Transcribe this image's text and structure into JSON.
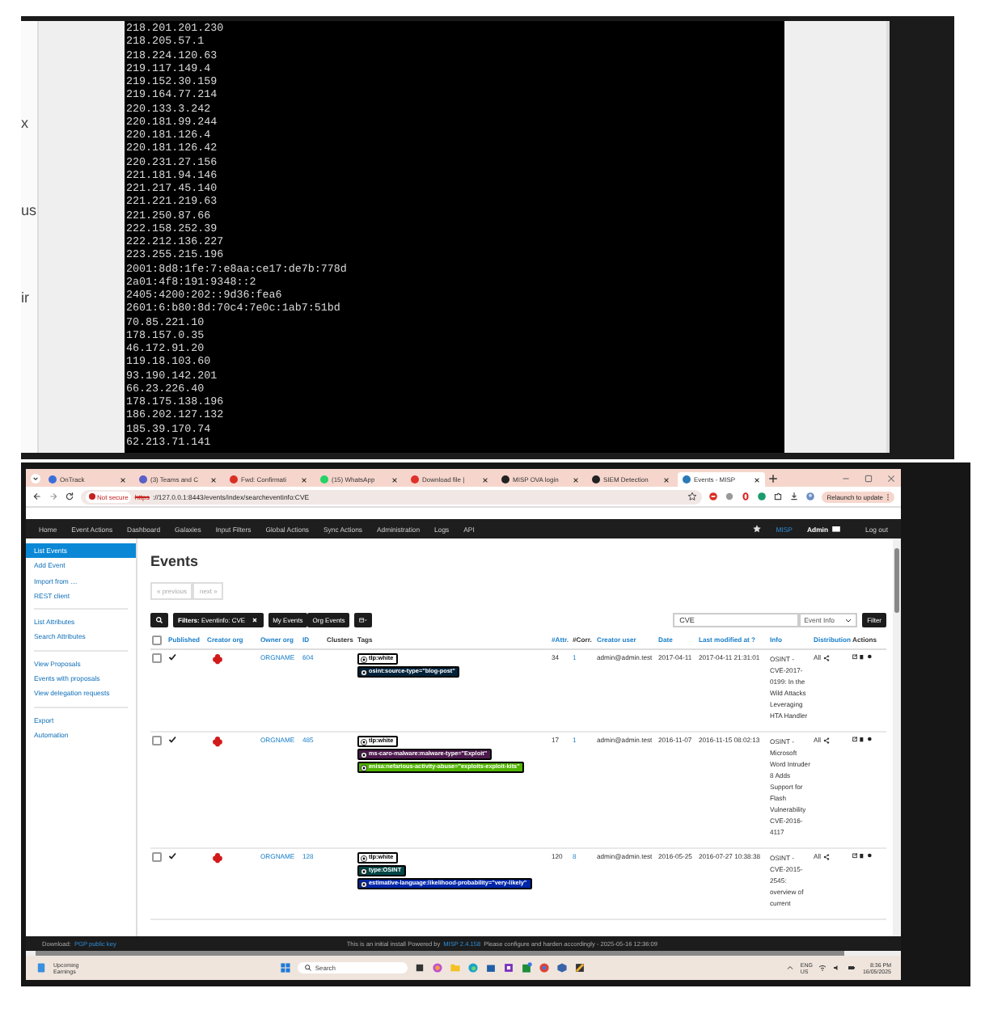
{
  "terminal": {
    "side_fragments": [
      "x",
      "us",
      "ir"
    ],
    "lines": [
      "218.201.201.230",
      "218.205.57.1",
      "218.224.120.63",
      "219.117.149.4",
      "219.152.30.159",
      "219.164.77.214",
      "220.133.3.242",
      "220.181.99.244",
      "220.181.126.4",
      "220.181.126.42",
      "220.231.27.156",
      "221.181.94.146",
      "221.217.45.140",
      "221.221.219.63",
      "221.250.87.66",
      "222.158.252.39",
      "222.212.136.227",
      "223.255.215.196",
      "2001:8d8:1fe:7:e8aa:ce17:de7b:778d",
      "2a01:4f8:191:9348::2",
      "2405:4200:202::9d36:fea6",
      "2601:6:b80:8d:70c4:7e0c:1ab7:51bd",
      "70.85.221.10",
      "178.157.0.35",
      "46.172.91.20",
      "119.18.103.60",
      "93.190.142.201",
      "66.23.226.40",
      "178.175.138.196",
      "186.202.127.132",
      "185.39.170.74",
      "62.213.71.141"
    ]
  },
  "browser": {
    "tabs": [
      {
        "label": "OnTrack",
        "selected": false,
        "color": "#3b6fd8"
      },
      {
        "label": "(3) Teams and C",
        "selected": false,
        "color": "#5b5fc7"
      },
      {
        "label": "Fwd: Confirmati",
        "selected": false,
        "color": "#d93025"
      },
      {
        "label": "(15) WhatsApp",
        "selected": false,
        "color": "#25d366"
      },
      {
        "label": "Download file | ",
        "selected": false,
        "color": "#e0302a"
      },
      {
        "label": "MISP OVA login",
        "selected": false,
        "color": "#222222"
      },
      {
        "label": "SIEM Detection",
        "selected": false,
        "color": "#222222"
      },
      {
        "label": "Events - MISP",
        "selected": true,
        "color": "#2a7ab8"
      }
    ],
    "security": "Not secure",
    "url_scheme": "https",
    "url_rest": "://127.0.0.1:8443/events/index/searcheventinfo:CVE",
    "relaunch": "Relaunch to update"
  },
  "nav": {
    "items": [
      "Home",
      "Event Actions",
      "Dashboard",
      "Galaxies",
      "Input Filters",
      "Global Actions",
      "Sync Actions",
      "Administration",
      "Logs",
      "API"
    ],
    "brand": "MISP",
    "user": "Admin",
    "logout": "Log out"
  },
  "sidebar": {
    "groups": [
      [
        {
          "label": "List Events",
          "selected": true
        },
        {
          "label": "Add Event",
          "selected": false
        },
        {
          "label": "Import from …",
          "selected": false
        },
        {
          "label": "REST client",
          "selected": false
        }
      ],
      [
        {
          "label": "List Attributes",
          "selected": false
        },
        {
          "label": "Search Attributes",
          "selected": false
        }
      ],
      [
        {
          "label": "View Proposals",
          "selected": false
        },
        {
          "label": "Events with proposals",
          "selected": false
        },
        {
          "label": "View delegation requests",
          "selected": false
        }
      ],
      [
        {
          "label": "Export",
          "selected": false
        },
        {
          "label": "Automation",
          "selected": false
        }
      ]
    ]
  },
  "main": {
    "title": "Events",
    "pager": [
      "« previous",
      "next »"
    ],
    "filter_tag": "**Filters:** Eventinfo: CVE",
    "my_events": "My Events",
    "org_events": "Org Events",
    "search_value": "CVE",
    "search_scope": "Event Info",
    "filter_button": "Filter"
  },
  "table": {
    "select_all_checked": false,
    "columns": [
      {
        "label": "Published",
        "sortable": true
      },
      {
        "label": "Creator org",
        "sortable": true
      },
      {
        "label": "Owner org",
        "sortable": true
      },
      {
        "label": "ID",
        "sortable": true
      },
      {
        "label": "Clusters",
        "sortable": false
      },
      {
        "label": "Tags",
        "sortable": false
      },
      {
        "label": "#Attr.",
        "sortable": true
      },
      {
        "label": "#Corr.",
        "sortable": false
      },
      {
        "label": "Creator user",
        "sortable": true
      },
      {
        "label": "Date",
        "sortable": true
      },
      {
        "label": "Last modified at ?",
        "sortable": true
      },
      {
        "label": "Info",
        "sortable": true
      },
      {
        "label": "Distribution",
        "sortable": true
      },
      {
        "label": "Actions",
        "sortable": false
      }
    ],
    "rows": [
      {
        "checked": false,
        "published": true,
        "owner_org": "ORGNAME",
        "id": "604",
        "tags": [
          {
            "label": "tlp:white",
            "color": "#ffffff"
          },
          {
            "label": "osint:source-type=\"blog-post\"",
            "color": "#00223b"
          }
        ],
        "attr": "34",
        "corr": "1",
        "creator_user": "admin@admin.test",
        "date": "2017-04-11",
        "modified": "2017-04-11 21:31:01",
        "info": "OSINT - CVE-2017-0199: In the Wild Attacks Leveraging HTA Handler",
        "distribution": "All"
      },
      {
        "checked": false,
        "published": true,
        "owner_org": "ORGNAME",
        "id": "485",
        "tags": [
          {
            "label": "tlp:white",
            "color": "#ffffff"
          },
          {
            "label": "ms-caro-malware:malware-type=\"Exploit\"",
            "color": "#4d1a4d"
          },
          {
            "label": "enisa:nefarious-activity-abuse=\"exploits-exploit-kits\"",
            "color": "#4fb300"
          }
        ],
        "attr": "17",
        "corr": "1",
        "creator_user": "admin@admin.test",
        "date": "2016-11-07",
        "modified": "2016-11-15 08:02:13",
        "info": "OSINT - Microsoft Word Intruder 8 Adds Support for Flash Vulnerability CVE-2016-4117",
        "distribution": "All"
      },
      {
        "checked": false,
        "published": true,
        "owner_org": "ORGNAME",
        "id": "128",
        "tags": [
          {
            "label": "tlp:white",
            "color": "#ffffff"
          },
          {
            "label": "type:OSINT",
            "color": "#004646"
          },
          {
            "label": "estimative-language:likelihood-probability=\"very-likely\"",
            "color": "#0026a8"
          }
        ],
        "attr": "120",
        "corr": "8",
        "creator_user": "admin@admin.test",
        "date": "2016-05-25",
        "modified": "2016-07-27 10:38:38",
        "info": "OSINT - CVE-2015-2545: overview of current",
        "distribution": "All"
      }
    ]
  },
  "footer": {
    "download_label": "Download:",
    "download_link": "PGP public key",
    "notice_before": "This is an initial install Powered by",
    "notice_link": "MISP 2.4.158",
    "notice_after": "Please configure and harden accordingly - 2025-05-16 12:36:09"
  },
  "taskbar": {
    "weather_title": "Upcoming",
    "weather_sub": "Earnings",
    "search": "Search",
    "lang": "ENG",
    "region": "US",
    "time": "8:36 PM",
    "date": "16/05/2025"
  }
}
